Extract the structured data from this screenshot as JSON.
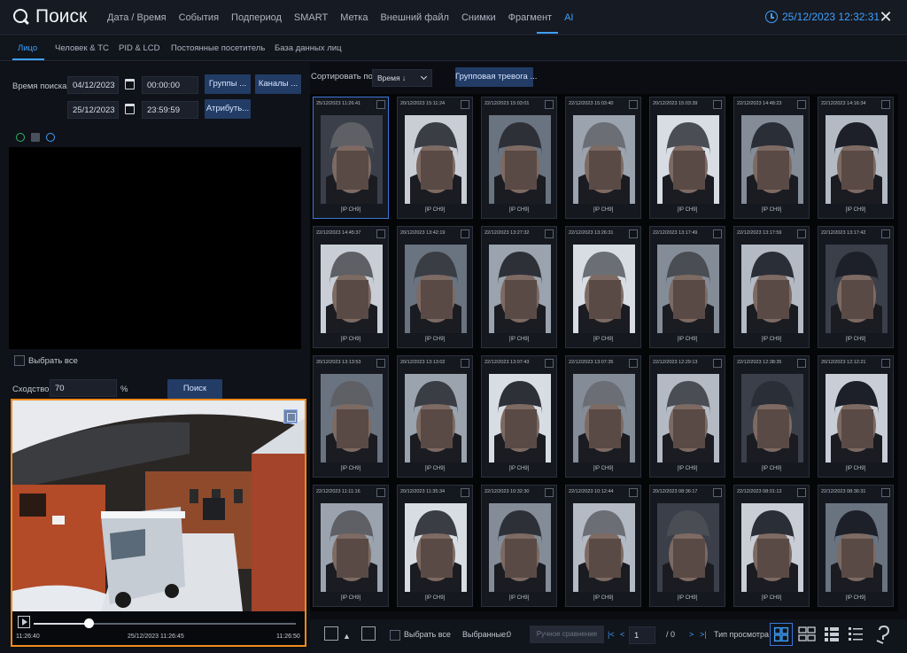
{
  "app": {
    "title": "Поиск"
  },
  "topnav": {
    "items": [
      {
        "label": "Дата / Время",
        "active": false
      },
      {
        "label": "События",
        "active": false
      },
      {
        "label": "Подпериод",
        "active": false
      },
      {
        "label": "SMART",
        "active": false
      },
      {
        "label": "Метка",
        "active": false
      },
      {
        "label": "Внешний файл",
        "active": false
      },
      {
        "label": "Снимки",
        "active": false
      },
      {
        "label": "Фрагмент",
        "active": false
      },
      {
        "label": "AI",
        "active": true
      }
    ],
    "clock": "25/12/2023 12:32:31"
  },
  "subtabs": [
    {
      "label": "Лицо",
      "active": true
    },
    {
      "label": "Человек & ТС",
      "active": false
    },
    {
      "label": "PID & LCD",
      "active": false
    },
    {
      "label": "Постоянные посетитель",
      "active": false
    },
    {
      "label": "База данных лиц",
      "active": false
    }
  ],
  "search": {
    "time_label": "Время поиска",
    "start_date": "04/12/2023",
    "start_time": "00:00:00",
    "end_date": "25/12/2023",
    "end_time": "23:59:59",
    "groups_button": "Группы ...",
    "channels_button": "Каналы ...",
    "attribute_button": "Атрибуть...",
    "select_all": "Выбрать все",
    "similarity_label": "Сходство:",
    "similarity_value": "70",
    "percent": "%",
    "search_button": "Поиск"
  },
  "video": {
    "time_start": "11:26:40",
    "time_mid": "25/12/2023 11:26:45",
    "time_end": "11:26:50",
    "progress": 0.21
  },
  "results": {
    "sort_label": "Сортировать по",
    "sort_value": "Время ↓",
    "group_alarm_button": "Групповая тревога ...",
    "thumbs": [
      {
        "time": "25/12/2023 11:26:41",
        "channel": "[IP CH9]",
        "selected": true
      },
      {
        "time": "20/12/2023 15:11:24",
        "channel": "[IP CH9]"
      },
      {
        "time": "22/12/2023 15:03:01",
        "channel": "[IP CH9]"
      },
      {
        "time": "22/12/2023 15:03:40",
        "channel": "[IP CH9]"
      },
      {
        "time": "20/12/2023 15:03:39",
        "channel": "[IP CH9]"
      },
      {
        "time": "22/12/2023 14:48:23",
        "channel": "[IP CH9]"
      },
      {
        "time": "22/12/2023 14:16:34",
        "channel": "[IP CH9]"
      },
      {
        "time": "22/12/2023 14:45:37",
        "channel": "[IP CH9]"
      },
      {
        "time": "20/12/2023 13:42:19",
        "channel": "[IP CH9]"
      },
      {
        "time": "22/12/2023 13:27:32",
        "channel": "[IP CH9]"
      },
      {
        "time": "22/12/2023 13:26:31",
        "channel": "[IP CH9]"
      },
      {
        "time": "22/12/2023 13:17:49",
        "channel": "[IP CH9]"
      },
      {
        "time": "22/12/2023 13:17:59",
        "channel": "[IP CH9]"
      },
      {
        "time": "22/12/2023 13:17:42",
        "channel": "[IP CH9]"
      },
      {
        "time": "20/12/2023 13:13:53",
        "channel": "[IP CH9]"
      },
      {
        "time": "20/12/2023 13:13:02",
        "channel": "[IP CH9]"
      },
      {
        "time": "22/12/2023 13:07:43",
        "channel": "[IP CH9]"
      },
      {
        "time": "22/12/2023 13:07:35",
        "channel": "[IP CH9]"
      },
      {
        "time": "22/12/2023 12:29:13",
        "channel": "[IP CH9]"
      },
      {
        "time": "22/12/2023 12:38:35",
        "channel": "[IP CH9]"
      },
      {
        "time": "20/12/2023 12:12:21",
        "channel": "[IP CH9]"
      },
      {
        "time": "22/12/2023 11:11:16",
        "channel": "[IP CH9]"
      },
      {
        "time": "20/12/2023 11:35:34",
        "channel": "[IP CH9]"
      },
      {
        "time": "22/12/2023 10:32:30",
        "channel": "[IP CH9]"
      },
      {
        "time": "22/12/2023 10:12:44",
        "channel": "[IP CH9]"
      },
      {
        "time": "20/12/2023 08:36:17",
        "channel": "[IP CH9]"
      },
      {
        "time": "22/12/2023 08:01:13",
        "channel": "[IP CH9]"
      },
      {
        "time": "22/12/2023 08:36:31",
        "channel": "[IP CH9]"
      }
    ]
  },
  "bottom": {
    "select_all": "Выбрать все",
    "selected_label": "Выбранные:",
    "selected_count": "0",
    "compare_button": "Ручное сравнение",
    "page_current": "1",
    "page_total": "/ 0",
    "view_mode_label": "Тип просмотра"
  },
  "colors": {
    "accent": "#3fa1ff",
    "video_border": "#f18b1c",
    "button": "#223c66"
  }
}
